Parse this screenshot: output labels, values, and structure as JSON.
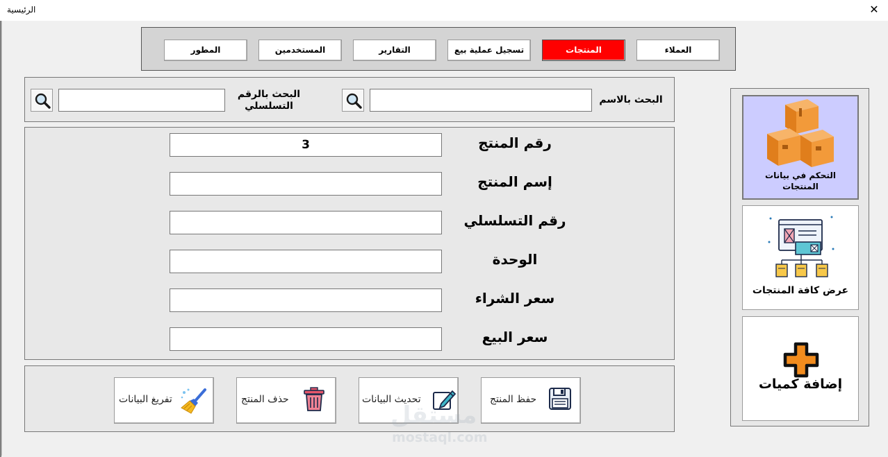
{
  "window": {
    "title": "الرئيسية",
    "close_glyph": "✕"
  },
  "tabs": [
    {
      "label": "العملاء",
      "active": false
    },
    {
      "label": "المنتجات",
      "active": true
    },
    {
      "label": "تسجيل عملية بيع",
      "active": false
    },
    {
      "label": "التقارير",
      "active": false
    },
    {
      "label": "المستخدمين",
      "active": false
    },
    {
      "label": "المطور",
      "active": false
    }
  ],
  "search": {
    "by_name_label": "البحث بالاسم",
    "by_name_value": "",
    "by_serial_label_line1": "البحث بالرقم",
    "by_serial_label_line2": "التسلسلي",
    "by_serial_value": "",
    "button_icon": "magnifier-icon"
  },
  "form": {
    "fields": [
      {
        "label": "رقم المنتج",
        "value": "3"
      },
      {
        "label": "إسم المنتج",
        "value": ""
      },
      {
        "label": "رقم التسلسلي",
        "value": ""
      },
      {
        "label": "الوحدة",
        "value": ""
      },
      {
        "label": "سعر الشراء",
        "value": ""
      },
      {
        "label": "سعر البيع",
        "value": ""
      }
    ]
  },
  "actions": {
    "save_label": "حفظ المنتج",
    "update_label": "تحديث البيانات",
    "delete_label": "حذف المنتج",
    "clear_label": "تفريغ البيانات"
  },
  "side": {
    "manage_line1": "التحكم في بيانات",
    "manage_line2": "المنتجات",
    "view_all_label": "عرض كافة المنتجات",
    "add_qty_label": "إضافة كميات"
  },
  "watermark": {
    "arabic": "مستقل",
    "latin": "mostaql.com"
  },
  "colors": {
    "active_tab": "#ff0000",
    "active_side": "#ccccff",
    "accent_orange": "#f28c1e"
  }
}
